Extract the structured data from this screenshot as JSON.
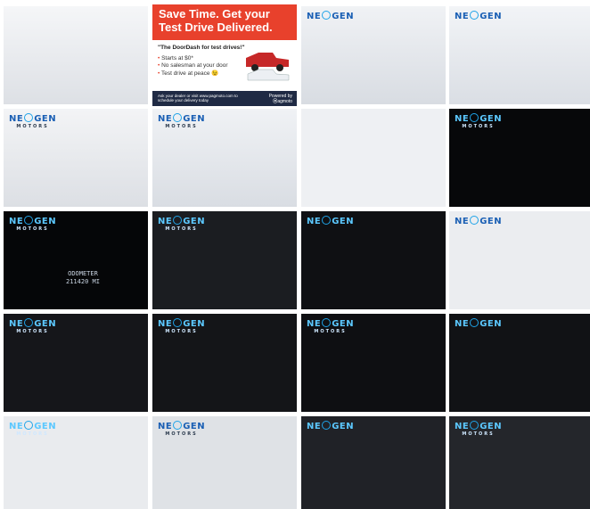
{
  "gallery": {
    "brand": {
      "name_left": "NE",
      "name_right": "GEN",
      "sub": "MOTORS"
    },
    "ad": {
      "headline_1": "Save Time. Get your",
      "headline_2": "Test Drive Delivered.",
      "quote": "\"The DoorDash for test drives!\"",
      "bullets": [
        "Starts at $0*",
        "No salesman at your door",
        "Test drive at peace 😉"
      ],
      "cta": "Ask your dealer or visit www.pagmoto.com to schedule your delivery today",
      "powered_by": "Powered by",
      "powered_name": "agmoto"
    },
    "odometer": {
      "label": "ODOMETER",
      "value": "211420 MI"
    },
    "colors": {
      "tile_dark": "#0c0d10",
      "tile_studio": "#e8eaee",
      "brand_blue": "#1a5fb4",
      "ad_red": "#e8412c"
    },
    "tiles": [
      {
        "name": "exterior-front-three-quarter"
      },
      {
        "name": "doordash-test-drive-ad"
      },
      {
        "name": "exterior-front-angle"
      },
      {
        "name": "exterior-front"
      },
      {
        "name": "headlight-left"
      },
      {
        "name": "grille-headlight"
      },
      {
        "name": "dashboard-overview"
      },
      {
        "name": "instrument-cluster"
      },
      {
        "name": "odometer-closeup"
      },
      {
        "name": "engine-bay"
      },
      {
        "name": "front-seats-center"
      },
      {
        "name": "dashboard-steering"
      },
      {
        "name": "center-console-wood"
      },
      {
        "name": "infotainment-controls"
      },
      {
        "name": "door-switches"
      },
      {
        "name": "seat-controls"
      },
      {
        "name": "driver-door-open"
      },
      {
        "name": "third-row-seats"
      },
      {
        "name": "rear-cabin-headliner"
      },
      {
        "name": "sunroof-interior"
      }
    ]
  }
}
